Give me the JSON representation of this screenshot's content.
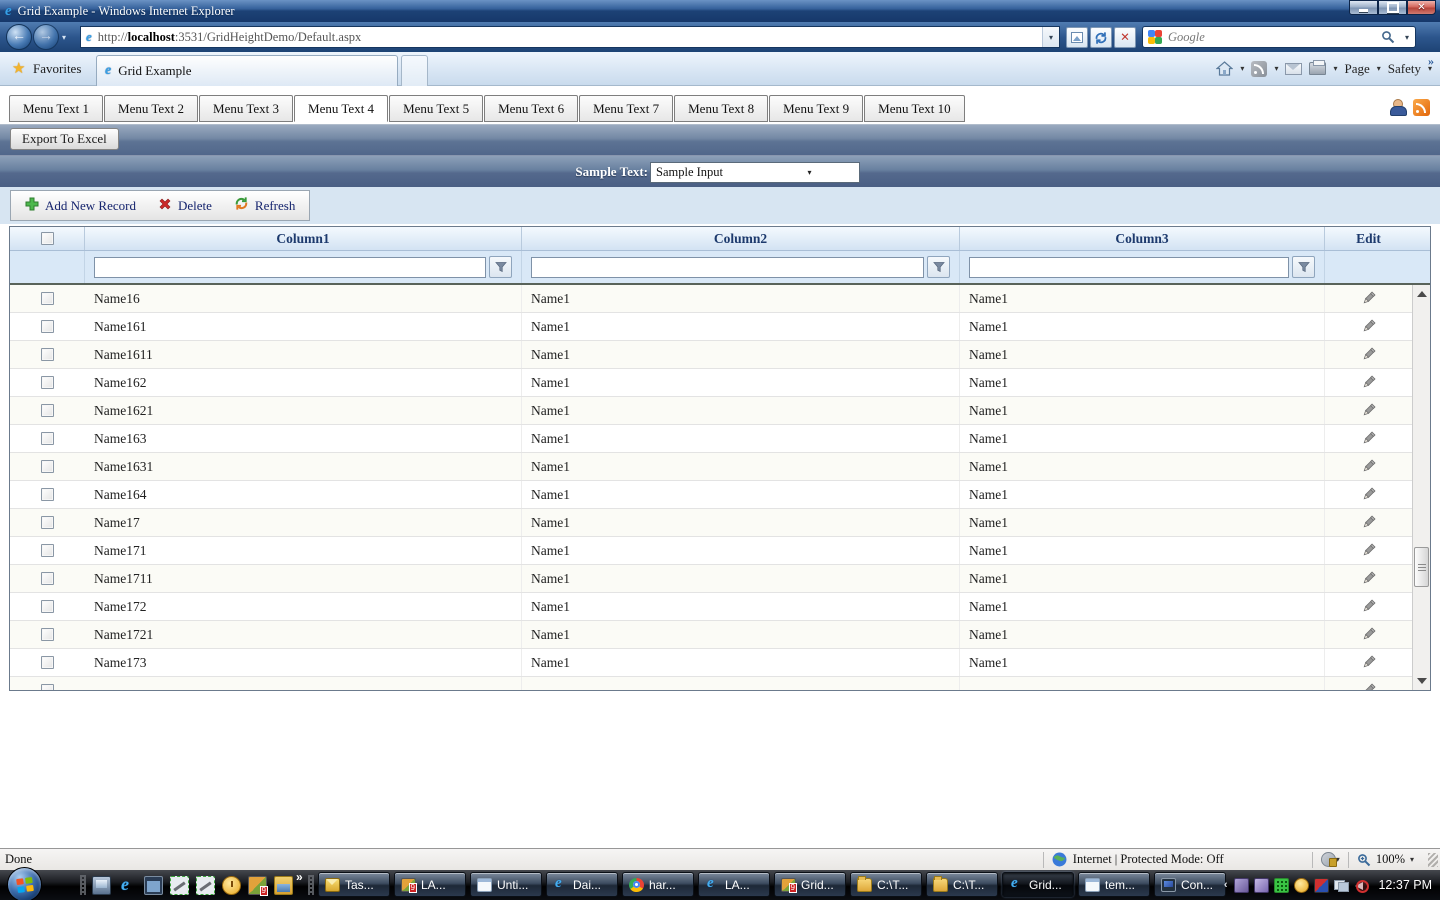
{
  "titlebar": {
    "title": "Grid Example - Windows Internet Explorer"
  },
  "address": {
    "protocol": "http://",
    "host": "localhost",
    "path": ":3531/GridHeightDemo/Default.aspx",
    "search_placeholder": "Google"
  },
  "favbar": {
    "favorites": "Favorites",
    "tab_title": "Grid Example",
    "page": "Page",
    "safety": "Safety"
  },
  "menu": {
    "tabs": [
      {
        "label": "Menu Text 1"
      },
      {
        "label": "Menu Text 2"
      },
      {
        "label": "Menu Text 3"
      },
      {
        "label": "Menu Text 4",
        "active": true
      },
      {
        "label": "Menu Text 5"
      },
      {
        "label": "Menu Text 6"
      },
      {
        "label": "Menu Text 7"
      },
      {
        "label": "Menu Text 8"
      },
      {
        "label": "Menu Text 9"
      },
      {
        "label": "Menu Text 10"
      }
    ]
  },
  "commands": {
    "export_label": "Export To Excel",
    "sample_label": "Sample Text:",
    "sample_value": "Sample Input"
  },
  "toolbar": {
    "buttons": [
      {
        "label": "Add New Record",
        "icon": "add"
      },
      {
        "label": "Delete",
        "icon": "delete"
      },
      {
        "label": "Refresh",
        "icon": "refresh"
      }
    ]
  },
  "grid": {
    "headers": {
      "c1": "Column1",
      "c2": "Column2",
      "c3": "Column3",
      "edit": "Edit"
    },
    "rows": [
      {
        "c1": "Name16",
        "c2": "Name1",
        "c3": "Name1"
      },
      {
        "c1": "Name161",
        "c2": "Name1",
        "c3": "Name1"
      },
      {
        "c1": "Name1611",
        "c2": "Name1",
        "c3": "Name1"
      },
      {
        "c1": "Name162",
        "c2": "Name1",
        "c3": "Name1"
      },
      {
        "c1": "Name1621",
        "c2": "Name1",
        "c3": "Name1"
      },
      {
        "c1": "Name163",
        "c2": "Name1",
        "c3": "Name1"
      },
      {
        "c1": "Name1631",
        "c2": "Name1",
        "c3": "Name1"
      },
      {
        "c1": "Name164",
        "c2": "Name1",
        "c3": "Name1"
      },
      {
        "c1": "Name17",
        "c2": "Name1",
        "c3": "Name1"
      },
      {
        "c1": "Name171",
        "c2": "Name1",
        "c3": "Name1"
      },
      {
        "c1": "Name1711",
        "c2": "Name1",
        "c3": "Name1"
      },
      {
        "c1": "Name172",
        "c2": "Name1",
        "c3": "Name1"
      },
      {
        "c1": "Name1721",
        "c2": "Name1",
        "c3": "Name1"
      },
      {
        "c1": "Name173",
        "c2": "Name1",
        "c3": "Name1"
      },
      {
        "c1": "",
        "c2": "",
        "c3": "",
        "partial": true
      }
    ]
  },
  "status": {
    "done": "Done",
    "zone": "Internet | Protected Mode: Off",
    "zoom": "100%"
  },
  "taskbar": {
    "quicklaunch": [
      "show-desktop",
      "ie",
      "window",
      "tool",
      "tool",
      "clock-app",
      "app9",
      "media-folder"
    ],
    "buttons": [
      {
        "label": "Tas...",
        "icon": "mail"
      },
      {
        "label": "LA...",
        "icon": "app9"
      },
      {
        "label": "Unti...",
        "icon": "notepad"
      },
      {
        "label": "Dai...",
        "icon": "ie"
      },
      {
        "label": "har...",
        "icon": "chrome"
      },
      {
        "label": "LA...",
        "icon": "ie"
      },
      {
        "label": "Grid...",
        "icon": "app9"
      },
      {
        "label": "C:\\T...",
        "icon": "folder"
      },
      {
        "label": "C:\\T...",
        "icon": "folder"
      },
      {
        "label": "Grid...",
        "icon": "ie",
        "active": true
      },
      {
        "label": "tem...",
        "icon": "notepad"
      },
      {
        "label": "Con...",
        "icon": "monitor"
      }
    ],
    "tray": [
      "purple-app",
      "purple-app2",
      "green-grid",
      "clock-yellow",
      "red-blue",
      "network",
      "volume-muted"
    ],
    "clock": "12:37 PM"
  }
}
